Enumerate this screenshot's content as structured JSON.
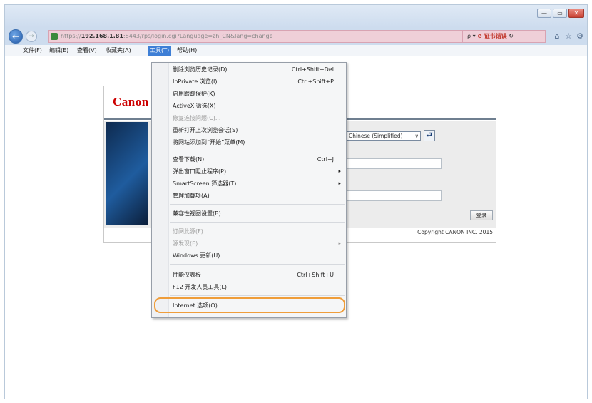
{
  "window": {
    "controls": [
      "—",
      "▭",
      "✕"
    ]
  },
  "address": {
    "url_prefix": "https://",
    "url_host": "192.168.1.81",
    "url_rest": ":8443/rps/login.cgi?Language=zh_CN&lang=change",
    "search_glyph": "ρ ▾",
    "cert_label": "证书错误",
    "refresh": "↻"
  },
  "toolbar": {
    "back": "←",
    "forward": "→",
    "home": "⌂",
    "favorites": "☆",
    "settings": "⚙"
  },
  "menubar": {
    "items": [
      {
        "label": "文件(F)"
      },
      {
        "label": "编辑(E)"
      },
      {
        "label": "查看(V)"
      },
      {
        "label": "收藏夹(A)"
      },
      {
        "label": "工具(T)"
      },
      {
        "label": "帮助(H)"
      }
    ]
  },
  "tools_menu": {
    "items": [
      {
        "label": "删除浏览历史记录(D)...",
        "shortcut": "Ctrl+Shift+Del",
        "submenu": false,
        "disabled": false
      },
      {
        "label": "InPrivate 浏览(I)",
        "shortcut": "Ctrl+Shift+P",
        "submenu": false,
        "disabled": false
      },
      {
        "label": "启用跟踪保护(K)",
        "shortcut": "",
        "submenu": false,
        "disabled": false
      },
      {
        "label": "ActiveX 筛选(X)",
        "shortcut": "",
        "submenu": false,
        "disabled": false
      },
      {
        "label": "修复连接问题(C)...",
        "shortcut": "",
        "submenu": false,
        "disabled": true
      },
      {
        "label": "重新打开上次浏览会话(S)",
        "shortcut": "",
        "submenu": false,
        "disabled": false
      },
      {
        "label": "将网站添加到“开始”菜单(M)",
        "shortcut": "",
        "submenu": false,
        "disabled": false
      },
      {
        "label": "查看下载(N)",
        "shortcut": "Ctrl+J",
        "submenu": false,
        "disabled": false
      },
      {
        "label": "弹出窗口阻止程序(P)",
        "shortcut": "",
        "submenu": true,
        "disabled": false
      },
      {
        "label": "SmartScreen 筛选器(T)",
        "shortcut": "",
        "submenu": true,
        "disabled": false
      },
      {
        "label": "管理加载项(A)",
        "shortcut": "",
        "submenu": false,
        "disabled": false
      },
      {
        "label": "兼容性视图设置(B)",
        "shortcut": "",
        "submenu": false,
        "disabled": false
      },
      {
        "label": "订阅此源(F)...",
        "shortcut": "",
        "submenu": false,
        "disabled": true
      },
      {
        "label": "源发现(E)",
        "shortcut": "",
        "submenu": true,
        "disabled": true
      },
      {
        "label": "Windows 更新(U)",
        "shortcut": "",
        "submenu": false,
        "disabled": false
      },
      {
        "label": "性能仪表板",
        "shortcut": "Ctrl+Shift+U",
        "submenu": false,
        "disabled": false
      },
      {
        "label": "F12 开发人员工具(L)",
        "shortcut": "",
        "submenu": false,
        "disabled": false
      },
      {
        "label": "Internet 选项(O)",
        "shortcut": "",
        "submenu": false,
        "disabled": false
      }
    ],
    "submenu_arrow": "▸"
  },
  "login_page": {
    "logo_text": "Canon",
    "language_value": "Chinese (Simplified)",
    "language_arrow": "∨",
    "go_glyph": "⮐",
    "login_button": "登录",
    "copyright": "Copyright CANON INC. 2015"
  },
  "colors": {
    "address_error_bg": "#efcfd8",
    "menu_active": "#3e7fd6",
    "highlight_ring": "#ef9d3a",
    "canon_red": "#cc0000"
  }
}
